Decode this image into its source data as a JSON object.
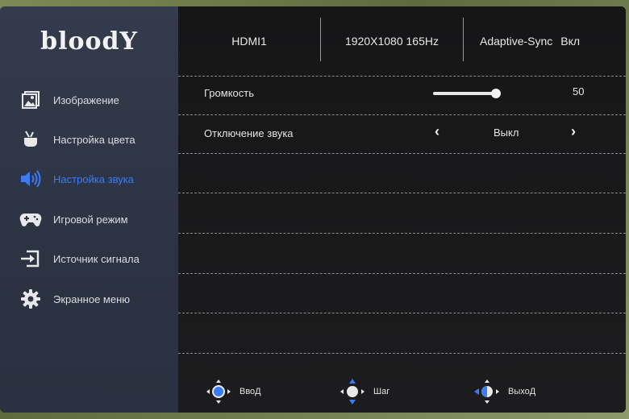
{
  "brand": "bloodY",
  "header": {
    "input": "HDMI1",
    "resolution": "1920X1080 165Hz",
    "adaptive_sync_label": "Adaptive-Sync",
    "adaptive_sync_value": "Вкл"
  },
  "sidebar": {
    "items": [
      {
        "label": "Изображение",
        "icon": "image-icon"
      },
      {
        "label": "Настройка цвета",
        "icon": "color-icon"
      },
      {
        "label": "Настройка звука",
        "icon": "speaker-icon",
        "active": true
      },
      {
        "label": "Игровой режим",
        "icon": "gamepad-icon"
      },
      {
        "label": "Источник сигнала",
        "icon": "input-source-icon"
      },
      {
        "label": "Экранное меню",
        "icon": "gear-icon"
      }
    ]
  },
  "settings": {
    "volume": {
      "label": "Громкость",
      "value": "50",
      "level": 0.5
    },
    "mute": {
      "label": "Отключение звука",
      "value": "Выкл"
    }
  },
  "footer": {
    "enter": "ВвоД",
    "step": "Шаг",
    "exit": "ВыхоД"
  },
  "colors": {
    "accent": "#3b7bf5",
    "sidebar": "#2f3646",
    "panel": "#19191b"
  }
}
